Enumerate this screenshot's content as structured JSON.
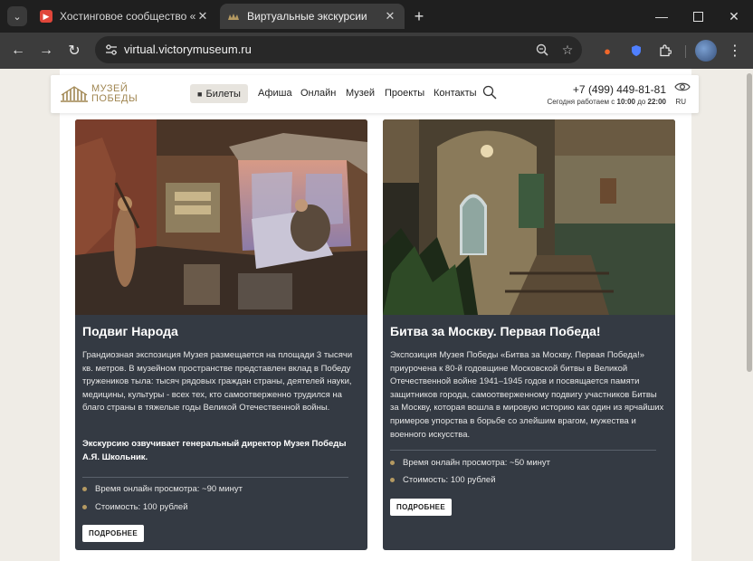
{
  "browser": {
    "tabs": [
      {
        "title": "Хостинговое сообщество «Tim",
        "icon": "timeweb-favicon",
        "active": false
      },
      {
        "title": "Виртуальные экскурсии",
        "icon": "museum-favicon",
        "active": true
      }
    ],
    "url": "virtual.victorymuseum.ru",
    "colors": {
      "frame": "#1f1f1f",
      "toolbar": "#3c3c3c",
      "omnibox": "#282828"
    }
  },
  "site": {
    "logo_line1": "МУЗЕЙ",
    "logo_line2": "ПОБЕДЫ",
    "tickets_label": "Билеты",
    "nav": [
      "Афиша",
      "Онлайн",
      "Музей",
      "Проекты",
      "Контакты"
    ],
    "phone": "+7 (499) 449-81-81",
    "hours_prefix": "Сегодня работаем с ",
    "hours_from": "10:00",
    "hours_mid": " до ",
    "hours_to": "22:00",
    "lang": "RU",
    "accent": "#b59a62"
  },
  "cards": [
    {
      "title": "Подвиг Народа",
      "description": "Грандиозная экспозиция Музея размещается на площади 3 тысячи кв. метров. В музейном пространстве представлен вклад в Победу тружеников тыла: тысяч рядовых граждан страны, деятелей науки, медицины, культуры - всех тех, кто самоотверженно трудился на благо страны в тяжелые годы Великой Отечественной войны.",
      "note": "Экскурсию озвучивает генеральный директор Музея Победы А.Я. Школьник.",
      "duration": "Время онлайн просмотра: ~90 минут",
      "price": "Стоимость: 100 рублей",
      "button": "ПОДРОБНЕЕ"
    },
    {
      "title": "Битва за Москву. Первая Победа!",
      "description": "Экспозиция Музея Победы «Битва за Москву. Первая Победа!» приурочена к 80-й годовщине Московской битвы в Великой Отечественной войне 1941–1945 годов и посвящается памяти защитников города, самоотверженному подвигу участников Битвы за Москву, которая вошла в мировую историю как один из ярчайших примеров упорства в борьбе со злейшим врагом, мужества и военного искусства.",
      "duration": "Время онлайн просмотра: ~50 минут",
      "price": "Стоимость: 100 рублей",
      "button": "ПОДРОБНЕЕ"
    }
  ]
}
